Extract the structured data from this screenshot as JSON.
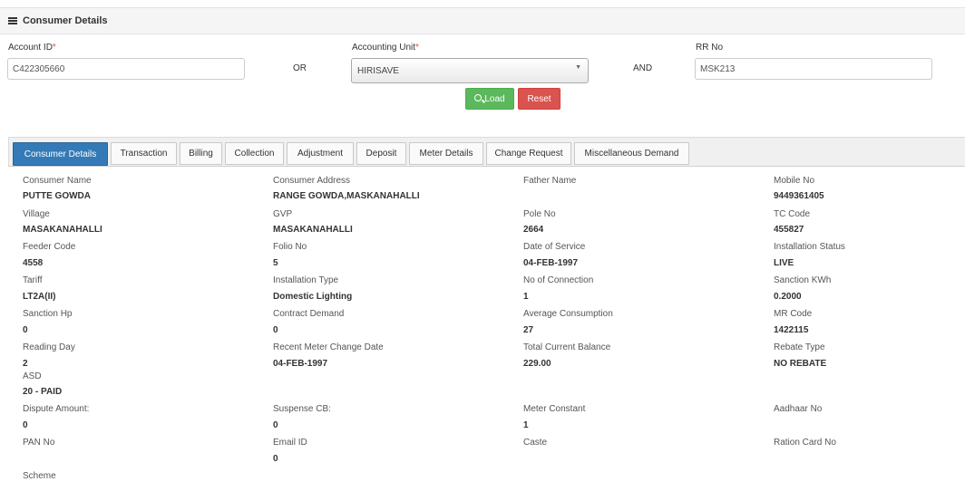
{
  "header": {
    "title": "Consumer Details"
  },
  "search": {
    "account_id_label": "Account ID",
    "account_id_value": "C422305660",
    "or_label": "OR",
    "accounting_unit_label": "Accounting Unit",
    "accounting_unit_value": "HIRISAVE",
    "and_label": "AND",
    "rr_no_label": "RR No",
    "rr_no_value": "MSK213",
    "required_mark": "*",
    "load_label": "Load",
    "reset_label": "Reset"
  },
  "tabs": [
    {
      "label": "Consumer Details",
      "active": true
    },
    {
      "label": "Transaction"
    },
    {
      "label": "Billing"
    },
    {
      "label": "Collection"
    },
    {
      "label": "Adjustment"
    },
    {
      "label": "Deposit"
    },
    {
      "label": "Meter Details"
    },
    {
      "label": "Change Request"
    },
    {
      "label": "Miscellaneous Demand"
    }
  ],
  "fields": {
    "consumer_name": {
      "label": "Consumer Name",
      "value": "PUTTE GOWDA"
    },
    "consumer_address": {
      "label": "Consumer Address",
      "value": "RANGE GOWDA,MASKANAHALLI"
    },
    "father_name": {
      "label": "Father Name",
      "value": ""
    },
    "mobile_no": {
      "label": "Mobile No",
      "value": "9449361405"
    },
    "village": {
      "label": "Village",
      "value": "MASAKANAHALLI"
    },
    "gvp": {
      "label": "GVP",
      "value": "MASAKANAHALLI"
    },
    "pole_no": {
      "label": "Pole No",
      "value": "2664"
    },
    "tc_code": {
      "label": "TC Code",
      "value": "455827"
    },
    "feeder_code": {
      "label": "Feeder Code",
      "value": "4558"
    },
    "folio_no": {
      "label": "Folio No",
      "value": "5"
    },
    "date_of_service": {
      "label": "Date of Service",
      "value": "04-FEB-1997"
    },
    "installation_status": {
      "label": "Installation Status",
      "value": "LIVE"
    },
    "tariff": {
      "label": "Tariff",
      "value": "LT2A(II)"
    },
    "installation_type": {
      "label": "Installation Type",
      "value": "Domestic Lighting"
    },
    "no_of_connection": {
      "label": "No of Connection",
      "value": "1"
    },
    "sanction_kwh": {
      "label": "Sanction KWh",
      "value": "0.2000"
    },
    "sanction_hp": {
      "label": "Sanction Hp",
      "value": "0"
    },
    "contract_demand": {
      "label": "Contract Demand",
      "value": "0"
    },
    "average_consumption": {
      "label": "Average Consumption",
      "value": "27"
    },
    "mr_code": {
      "label": "MR Code",
      "value": "1422115"
    },
    "reading_day": {
      "label": "Reading Day",
      "value": "2"
    },
    "recent_meter_change_date": {
      "label": "Recent Meter Change Date",
      "value": "04-FEB-1997"
    },
    "total_current_balance": {
      "label": "Total Current Balance",
      "value": "229.00"
    },
    "rebate_type": {
      "label": "Rebate Type",
      "value": "NO REBATE"
    },
    "asd": {
      "label": "ASD",
      "value": "20 - PAID"
    },
    "dispute_amount": {
      "label": "Dispute Amount:",
      "value": "0"
    },
    "suspense_cb": {
      "label": "Suspense CB:",
      "value": "0"
    },
    "meter_constant": {
      "label": "Meter Constant",
      "value": "1"
    },
    "aadhaar_no": {
      "label": "Aadhaar No",
      "value": ""
    },
    "pan_no": {
      "label": "PAN No",
      "value": ""
    },
    "email_id": {
      "label": "Email ID",
      "value": "0"
    },
    "caste": {
      "label": "Caste",
      "value": ""
    },
    "ration_card_no": {
      "label": "Ration Card No",
      "value": ""
    },
    "scheme": {
      "label": "Scheme",
      "value": ""
    }
  },
  "colors": {
    "primary": "#337ab7",
    "success": "#5cb85c",
    "danger": "#d9534f"
  },
  "icons": {
    "menu": "hamburger-icon",
    "search": "search-icon",
    "dropdown": "caret-down-icon"
  }
}
